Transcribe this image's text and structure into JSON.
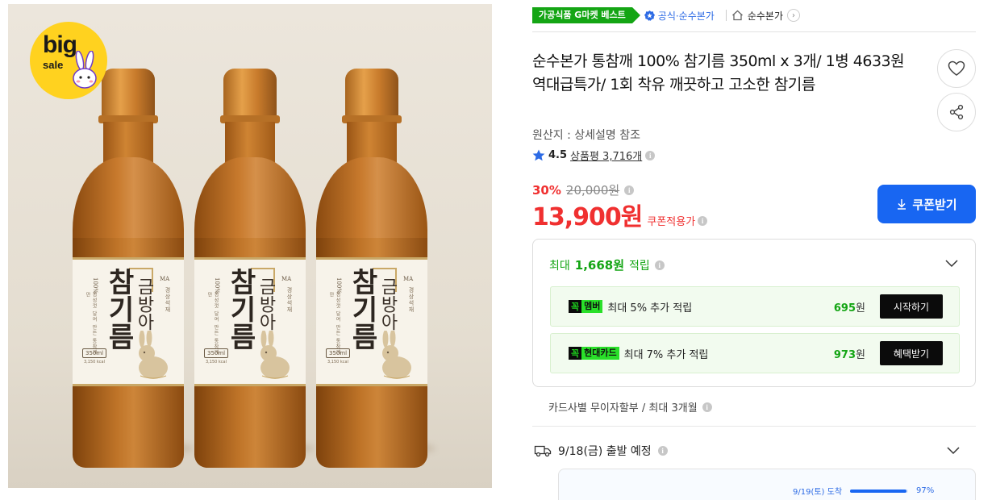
{
  "product_image": {
    "badge": {
      "big": "big",
      "sale": "sale"
    },
    "bottle_label": {
      "logo": "MA",
      "side_text": "경상석재",
      "percent_text": "100%",
      "description": "정성껏 달여 만든 통참깨만",
      "main_name": "참기름",
      "brand_name": "금방아",
      "volume": "350ml",
      "kcal": "3,150 kcal"
    },
    "bottle_count": 3
  },
  "tags": {
    "best_label": "가공식품 G마켓 베스트",
    "official_label": "공식·순수본가",
    "store_name": "순수본가"
  },
  "product": {
    "title": "순수본가 통참깨 100% 참기름 350ml x 3개/ 1병 4633원 역대급특가/ 1회 착유 깨끗하고 고소한 참기름",
    "origin": "원산지 : 상세설명 참조",
    "rating": "4.5",
    "review_label": "상품평 3,716개"
  },
  "pricing": {
    "discount_rate": "30%",
    "original_price": "20,000원",
    "sale_price": "13,900원",
    "coupon_applied": "쿠폰적용가",
    "coupon_button": "쿠폰받기"
  },
  "rewards": {
    "headline_prefix": "최대",
    "headline_amount": "1,668원",
    "headline_suffix": "적립",
    "rows": [
      {
        "tag_g": "꼭",
        "tag_w": "멤버",
        "desc": "최대 5% 추가 적립",
        "amount": "695",
        "unit": "원",
        "action": "시작하기"
      },
      {
        "tag_g": "꼭",
        "tag_w": "현대카드",
        "desc": "최대 7% 추가 적립",
        "amount": "973",
        "unit": "원",
        "action": "혜택받기"
      }
    ]
  },
  "installment": "카드사별 무이자할부 / 최대 3개월",
  "delivery": {
    "departure": "9/18(금) 출발 예정",
    "arrival_label": "9/19(토) 도착",
    "arrival_percent": "97%",
    "arrival_fraction": 0.97
  },
  "colors": {
    "accent_blue": "#1866f2",
    "price_red": "#f03030",
    "reward_green": "#14a514"
  },
  "icons": [
    "heart-icon",
    "share-icon",
    "home-icon",
    "official-badge-icon",
    "star-icon",
    "info-icon",
    "chevron-down-icon",
    "download-icon",
    "truck-icon"
  ]
}
